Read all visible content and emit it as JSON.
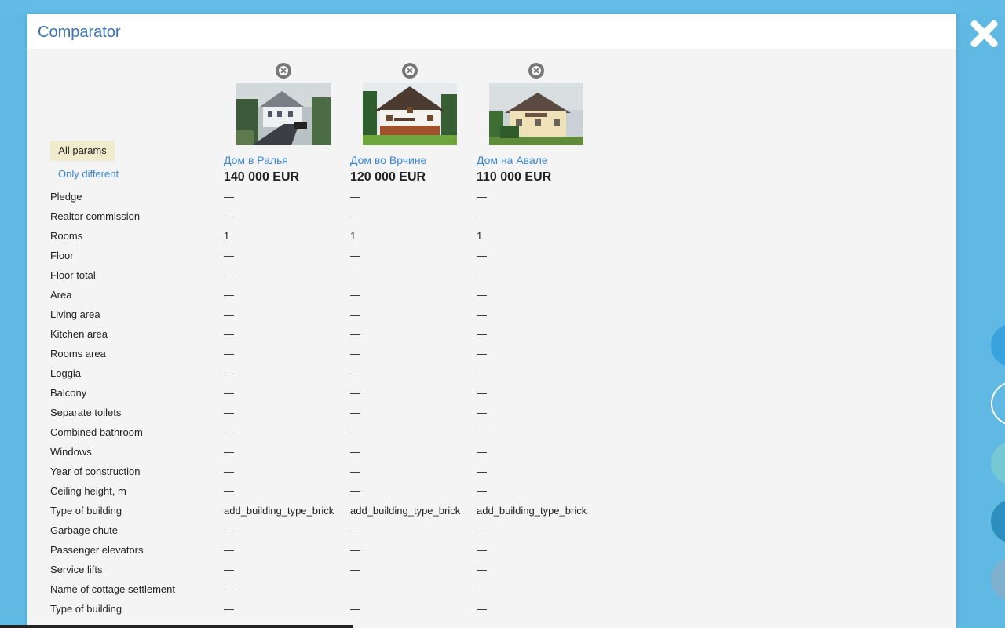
{
  "modal": {
    "title": "Comparator",
    "filters": {
      "all_params": "All params",
      "only_different": "Only different"
    }
  },
  "properties": [
    {
      "title": "Дом в Ралья",
      "price": "140 000 EUR"
    },
    {
      "title": "Дом во Врчине",
      "price": "120 000 EUR"
    },
    {
      "title": "Дом на Авале",
      "price": "110 000 EUR"
    }
  ],
  "params": [
    {
      "label": "Pledge",
      "values": [
        "—",
        "—",
        "—"
      ]
    },
    {
      "label": "Realtor commission",
      "values": [
        "—",
        "—",
        "—"
      ]
    },
    {
      "label": "Rooms",
      "values": [
        "1",
        "1",
        "1"
      ]
    },
    {
      "label": "Floor",
      "values": [
        "—",
        "—",
        "—"
      ]
    },
    {
      "label": "Floor total",
      "values": [
        "—",
        "—",
        "—"
      ]
    },
    {
      "label": "Area",
      "values": [
        "—",
        "—",
        "—"
      ]
    },
    {
      "label": "Living area",
      "values": [
        "—",
        "—",
        "—"
      ]
    },
    {
      "label": "Kitchen area",
      "values": [
        "—",
        "—",
        "—"
      ]
    },
    {
      "label": "Rooms area",
      "values": [
        "—",
        "—",
        "—"
      ]
    },
    {
      "label": "Loggia",
      "values": [
        "—",
        "—",
        "—"
      ]
    },
    {
      "label": "Balcony",
      "values": [
        "—",
        "—",
        "—"
      ]
    },
    {
      "label": "Separate toilets",
      "values": [
        "—",
        "—",
        "—"
      ]
    },
    {
      "label": "Combined bathroom",
      "values": [
        "—",
        "—",
        "—"
      ]
    },
    {
      "label": "Windows",
      "values": [
        "—",
        "—",
        "—"
      ]
    },
    {
      "label": "Year of construction",
      "values": [
        "—",
        "—",
        "—"
      ]
    },
    {
      "label": "Ceiling height, m",
      "values": [
        "—",
        "—",
        "—"
      ]
    },
    {
      "label": "Type of building",
      "values": [
        "add_building_type_brick",
        "add_building_type_brick",
        "add_building_type_brick"
      ]
    },
    {
      "label": "Garbage chute",
      "values": [
        "—",
        "—",
        "—"
      ]
    },
    {
      "label": "Passenger elevators",
      "values": [
        "—",
        "—",
        "—"
      ]
    },
    {
      "label": "Service lifts",
      "values": [
        "—",
        "—",
        "—"
      ]
    },
    {
      "label": "Name of cottage settlement",
      "values": [
        "—",
        "—",
        "—"
      ]
    },
    {
      "label": "Type of building",
      "values": [
        "—",
        "—",
        "—"
      ]
    }
  ],
  "colors": {
    "background": "#5fb9e3",
    "title_blue": "#3a72b6",
    "link_blue": "#3a87d6",
    "active_filter": "#f1ebcd"
  },
  "icons": [
    "close-icon",
    "remove-circle-icon"
  ]
}
